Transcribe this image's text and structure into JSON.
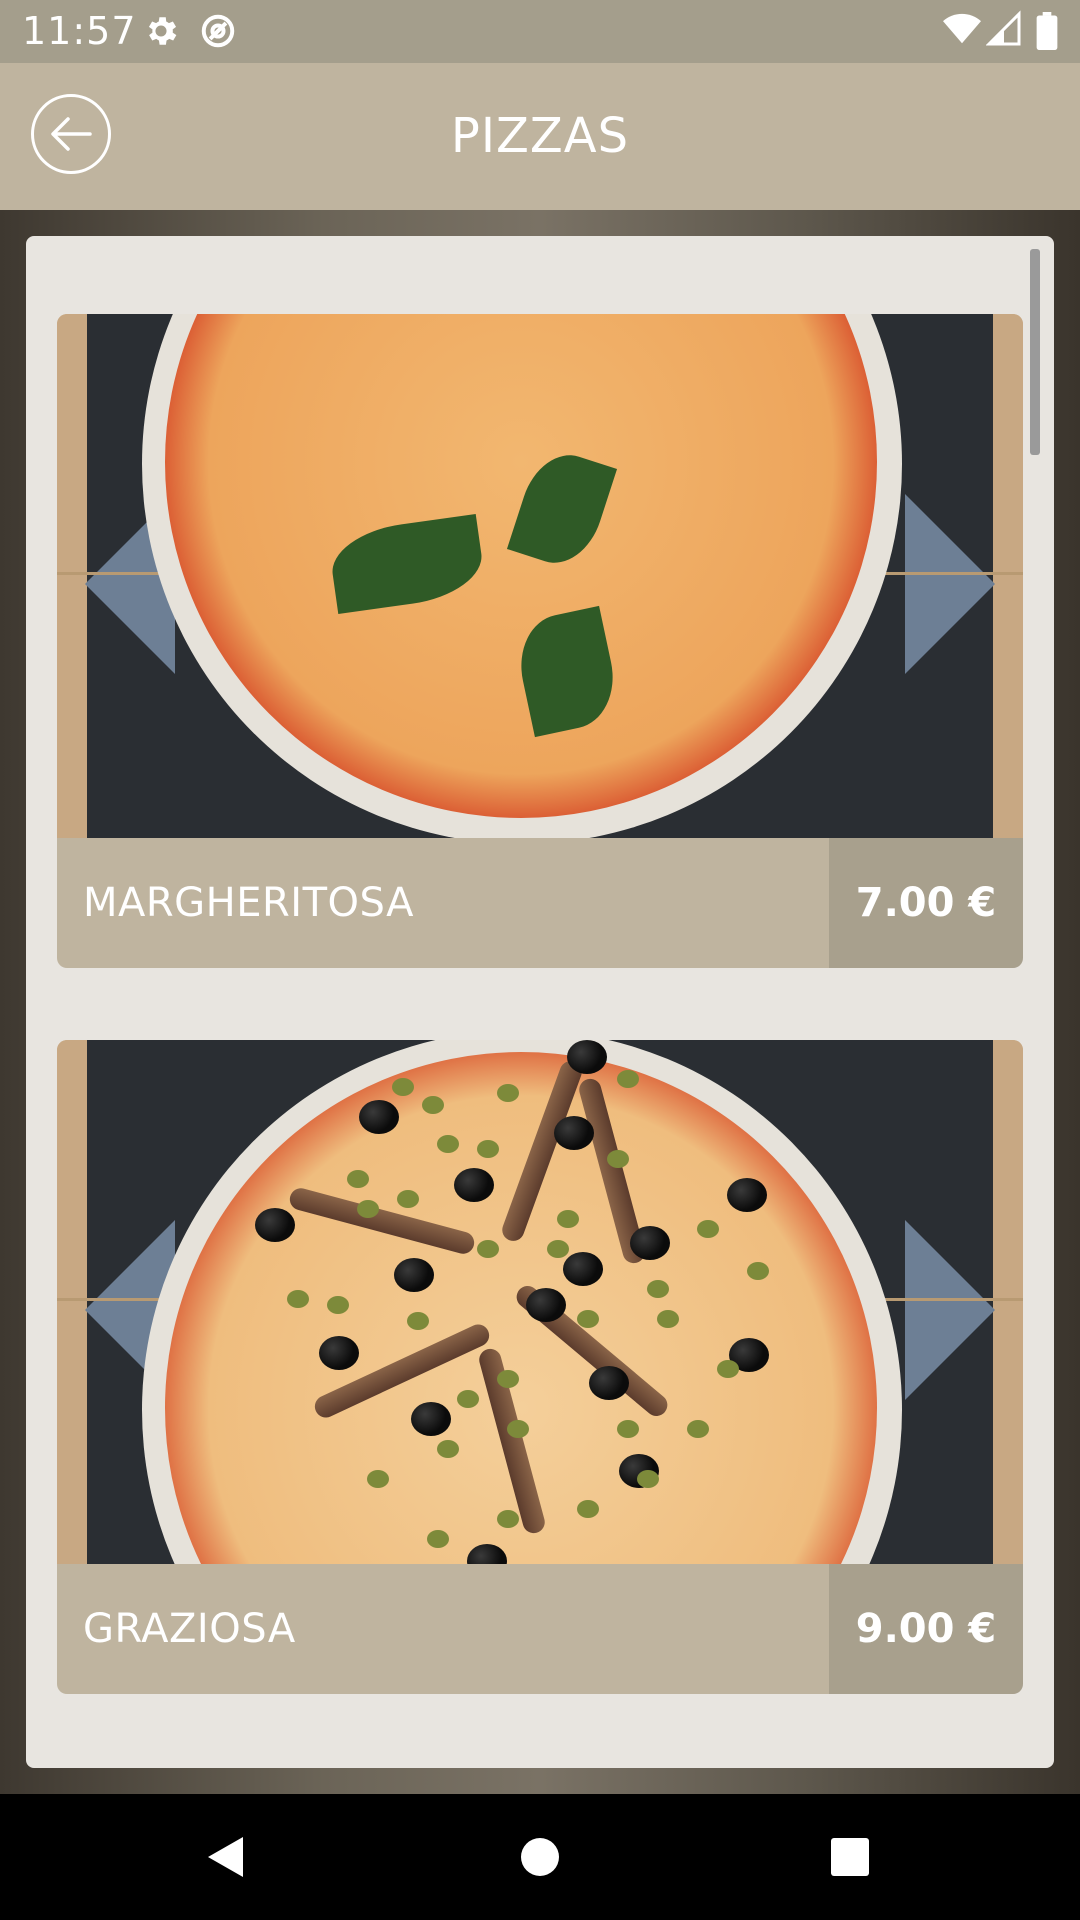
{
  "status_bar": {
    "time": "11:57",
    "icons": [
      "settings-icon",
      "at-sign-icon",
      "wifi-icon",
      "signal-icon",
      "battery-icon"
    ]
  },
  "app_bar": {
    "title": "PIZZAS",
    "back_icon": "arrow-left-icon"
  },
  "pizzas": [
    {
      "name": "MARGHERITOSA",
      "price": "7.00 €",
      "image": "margherita-pizza-photo"
    },
    {
      "name": "GRAZIOSA",
      "price": "9.00 €",
      "image": "anchovy-olive-pizza-photo"
    }
  ],
  "nav_bar": {
    "buttons": [
      "back-triangle-icon",
      "home-circle-icon",
      "recents-square-icon"
    ]
  },
  "colors": {
    "app_bar": "#bfb49f",
    "status_bar": "#a49e8c",
    "price_bg": "#a8a08d",
    "panel": "#e8e5e0"
  }
}
